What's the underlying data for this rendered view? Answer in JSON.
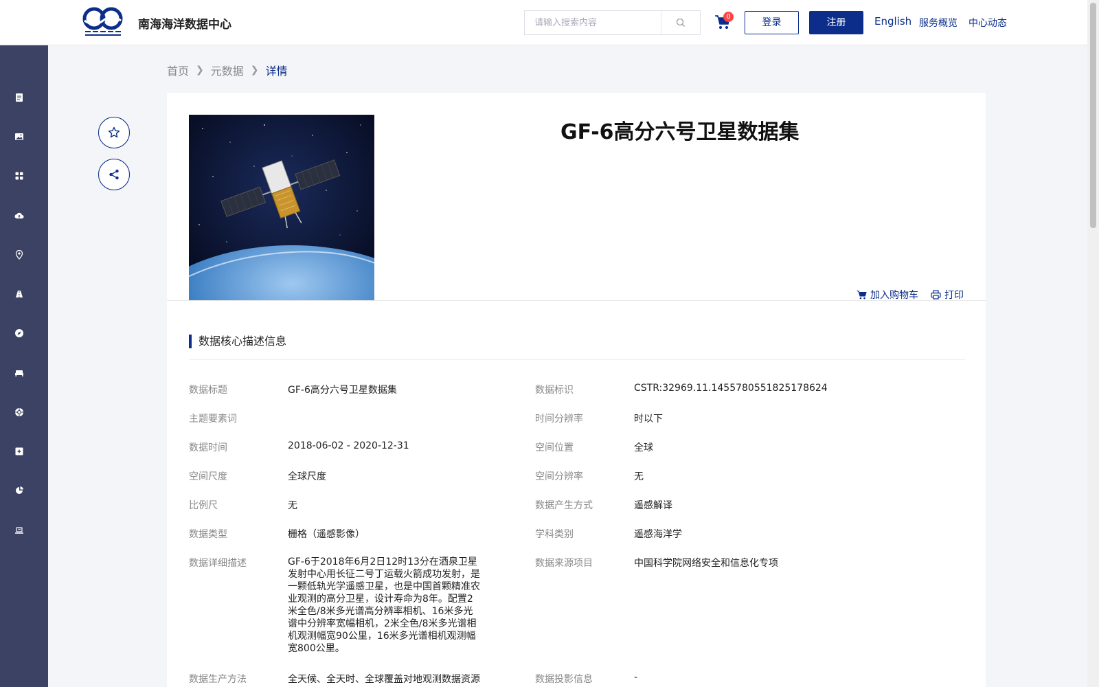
{
  "header": {
    "site_name": "南海海洋数据中心",
    "search_placeholder": "请输入搜索内容",
    "cart_count": "0",
    "login_label": "登录",
    "register_label": "注册",
    "nav_english": "English",
    "nav_overview": "服务概览",
    "nav_news": "中心动态"
  },
  "sidebar": {
    "icons": [
      "document-icon",
      "image-icon",
      "grid-icon",
      "cloud-upload-icon",
      "location-pin-icon",
      "road-icon",
      "compass-icon",
      "bed-icon",
      "globe-icon",
      "plus-square-icon",
      "pie-chart-icon",
      "laptop-icon"
    ]
  },
  "breadcrumb": {
    "home": "首页",
    "metadata": "元数据",
    "current": "详情"
  },
  "dataset": {
    "title": "GF-6高分六号卫星数据集",
    "add_to_cart": "加入购物车",
    "print": "打印"
  },
  "section": {
    "title": "数据核心描述信息"
  },
  "fields": {
    "data_title_label": "数据标题",
    "data_title_value": "GF-6高分六号卫星数据集",
    "data_id_label": "数据标识",
    "data_id_value": "CSTR:32969.11.1455780551825178624",
    "keywords_label": "主题要素词",
    "keywords_value": "",
    "time_res_label": "时间分辨率",
    "time_res_value": "时以下",
    "data_time_label": "数据时间",
    "data_time_value": "2018-06-02 - 2020-12-31",
    "spatial_loc_label": "空间位置",
    "spatial_loc_value": "全球",
    "spatial_scale_label": "空间尺度",
    "spatial_scale_value": "全球尺度",
    "spatial_res_label": "空间分辨率",
    "spatial_res_value": "无",
    "scale_label": "比例尺",
    "scale_value": "无",
    "generation_label": "数据产生方式",
    "generation_value": "遥感解译",
    "data_type_label": "数据类型",
    "data_type_value": "栅格（遥感影像）",
    "discipline_label": "学科类别",
    "discipline_value": "遥感海洋学",
    "description_label": "数据详细描述",
    "description_value": "GF-6于2018年6月2日12时13分在酒泉卫星发射中心用长征二号丁运载火箭成功发射，是一颗低轨光学遥感卫星，也是中国首颗精准农业观测的高分卫星，设计寿命为8年。配置2米全色/8米多光谱高分辨率相机、16米多光谱中分辨率宽幅相机，2米全色/8米多光谱相机观测幅宽90公里，16米多光谱相机观测幅宽800公里。",
    "source_project_label": "数据来源项目",
    "source_project_value": "中国科学院网络安全和信息化专项",
    "production_label": "数据生产方法",
    "production_value": "全天候、全天时、全球覆盖对地观测数据资源",
    "projection_label": "数据投影信息",
    "projection_value": "-"
  },
  "colors": {
    "brand": "#0c2e8a",
    "sidebar": "#3b4263"
  }
}
